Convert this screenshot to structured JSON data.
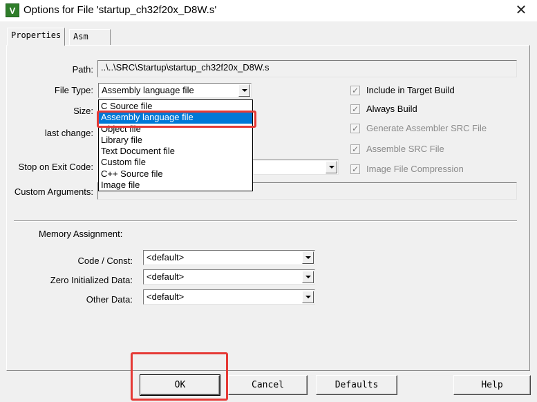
{
  "window": {
    "title": "Options for File 'startup_ch32f20x_D8W.s'",
    "app_icon_glyph": "V",
    "close_glyph": "✕"
  },
  "tabs": [
    {
      "label": "Properties",
      "active": true
    },
    {
      "label": "Asm",
      "active": false
    }
  ],
  "properties": {
    "path_label": "Path:",
    "path_value": "..\\..\\SRC\\Startup\\startup_ch32f20x_D8W.s",
    "file_type_label": "File Type:",
    "file_type_value": "Assembly language file",
    "size_label": "Size:",
    "last_change_label": "last change:",
    "stop_on_exit_label": "Stop on Exit Code:",
    "custom_args_label": "Custom Arguments:",
    "file_type_options": [
      "C Source file",
      "Assembly language file",
      "Object file",
      "Library file",
      "Text Document file",
      "Custom file",
      "C++ Source file",
      "Image file"
    ],
    "selected_option_index": 1
  },
  "checkboxes": [
    {
      "label": "Include in Target Build",
      "checked": true,
      "enabled": true
    },
    {
      "label": "Always Build",
      "checked": true,
      "enabled": true
    },
    {
      "label": "Generate Assembler SRC File",
      "checked": true,
      "enabled": false
    },
    {
      "label": "Assemble SRC File",
      "checked": true,
      "enabled": false
    },
    {
      "label": "Image File Compression",
      "checked": true,
      "enabled": false
    }
  ],
  "memory": {
    "title": "Memory Assignment:",
    "rows": [
      {
        "label": "Code / Const:",
        "value": "<default>"
      },
      {
        "label": "Zero Initialized Data:",
        "value": "<default>"
      },
      {
        "label": "Other Data:",
        "value": "<default>"
      }
    ]
  },
  "buttons": {
    "ok": "OK",
    "cancel": "Cancel",
    "defaults": "Defaults",
    "help": "Help"
  },
  "colors": {
    "selection": "#0078d7",
    "highlight_annotation": "#e53935"
  }
}
